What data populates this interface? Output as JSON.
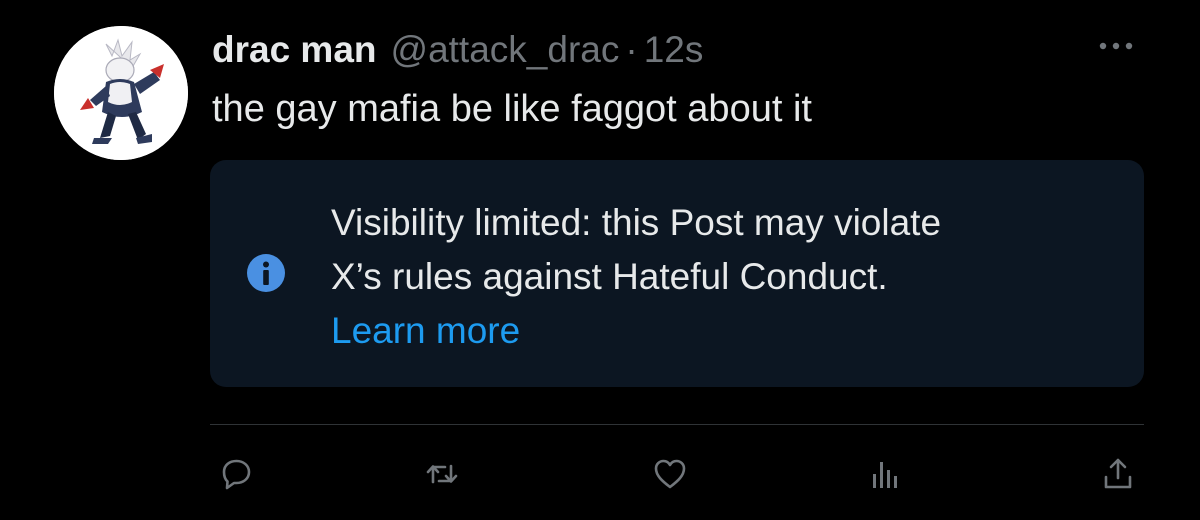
{
  "post": {
    "display_name": "drac man",
    "handle": "@attack_drac",
    "separator": "·",
    "timestamp": "12s",
    "text": "the gay mafia be like faggot about it"
  },
  "notice": {
    "line1": "Visibility limited: this Post may violate",
    "line2": "X’s rules against Hateful Conduct.",
    "link": "Learn more"
  },
  "actions": [
    "reply",
    "repost",
    "like",
    "views",
    "share"
  ],
  "icons": {
    "avatar": "pokemon-character-avatar",
    "more": "more-dots-icon",
    "info": "info-icon",
    "reply": "reply-icon",
    "repost": "repost-icon",
    "like": "heart-icon",
    "views": "analytics-icon",
    "share": "share-icon"
  },
  "colors": {
    "background": "#000000",
    "text_primary": "#e7e9ea",
    "text_secondary": "#71767b",
    "accent": "#1d9bf0",
    "notice_background": "#0c1622",
    "info_icon": "#4a90e2"
  }
}
